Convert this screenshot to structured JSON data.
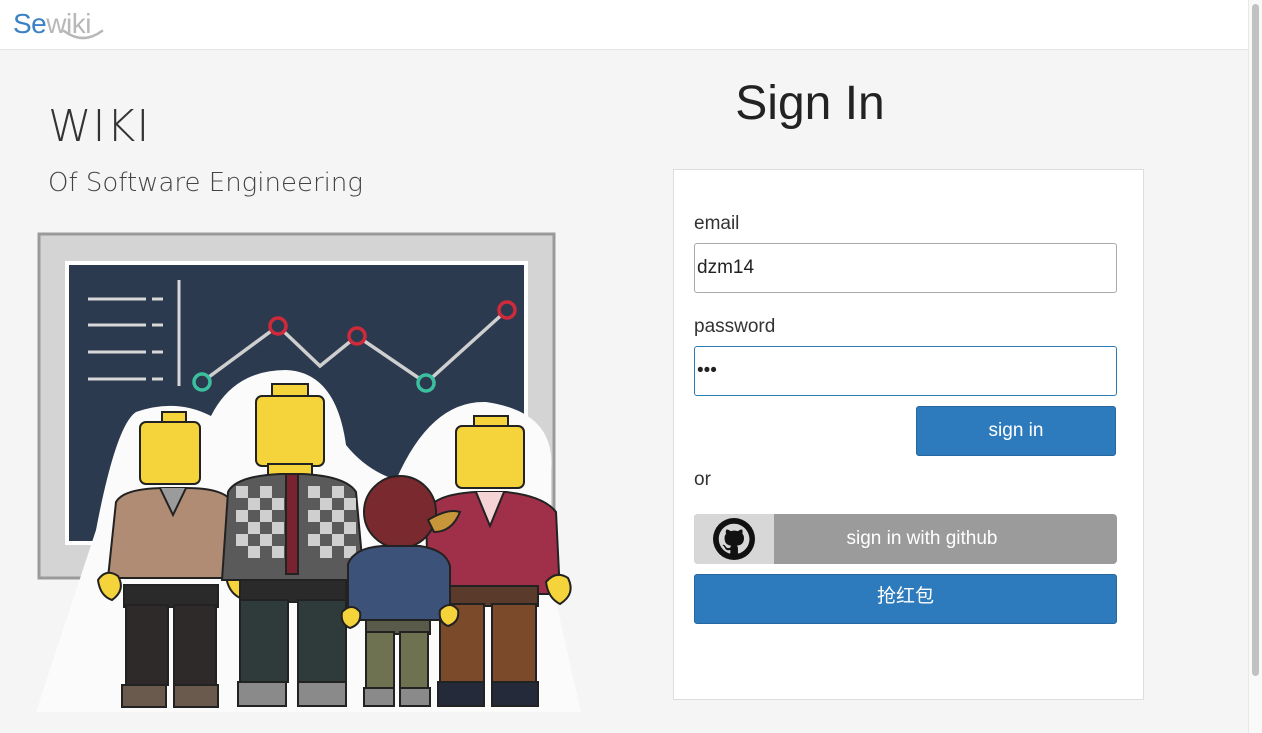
{
  "header": {
    "logo": {
      "part1": "Se",
      "part2": "wiki",
      "brand_color": "#3b82c4",
      "accent_color": "#b8b8b8"
    }
  },
  "hero": {
    "title": "WIKI",
    "subtitle": "Of Software Engineering",
    "illustration": {
      "icon": "lego-team-chalkboard-illustration",
      "chart_points_colors": [
        "#3bbf9e",
        "#cf2a3a"
      ]
    }
  },
  "signin": {
    "heading": "Sign In",
    "email_label": "email",
    "email_value": "dzm14",
    "password_label": "password",
    "password_value": "abc",
    "signin_button": "sign in",
    "or_text": "or",
    "github_icon": "github-icon",
    "github_button": "sign in with github",
    "red_packet_button": "抢红包",
    "primary_color": "#2d7bbc"
  }
}
